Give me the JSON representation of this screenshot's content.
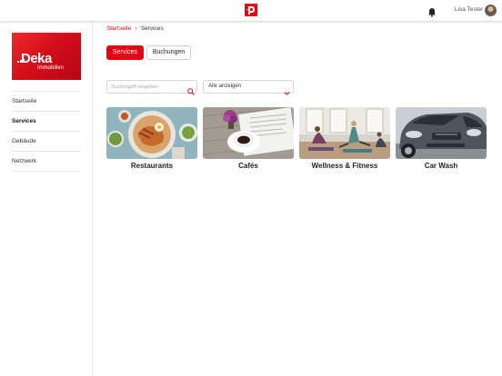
{
  "header": {
    "app_logo": "app-logo-icon",
    "notification_icon": "bell-icon",
    "user_name": "Lisa Tester"
  },
  "sidebar": {
    "brand": {
      "name": "Deka",
      "subtitle": "Immobilien",
      "color": "#e30613"
    },
    "items": [
      {
        "label": "Startseite",
        "active": false
      },
      {
        "label": "Services",
        "active": true
      },
      {
        "label": "Gebäude",
        "active": false
      },
      {
        "label": "Netzwerk",
        "active": false
      }
    ]
  },
  "breadcrumb": {
    "home": "Startseite",
    "current": "Services"
  },
  "tabs": [
    {
      "label": "Services",
      "active": true
    },
    {
      "label": "Buchungen",
      "active": false
    }
  ],
  "filters": {
    "search_placeholder": "Suchbegriff eingeben",
    "category_value": "Alle anzeigen"
  },
  "services": [
    {
      "label": "Restaurants",
      "image": "restaurant-food-image"
    },
    {
      "label": "Cafés",
      "image": "coffee-newspaper-image"
    },
    {
      "label": "Wellness & Fitness",
      "image": "yoga-class-image"
    },
    {
      "label": "Car Wash",
      "image": "car-image"
    }
  ],
  "colors": {
    "accent": "#e30613",
    "text": "#222222",
    "border": "#d5d5d5"
  }
}
